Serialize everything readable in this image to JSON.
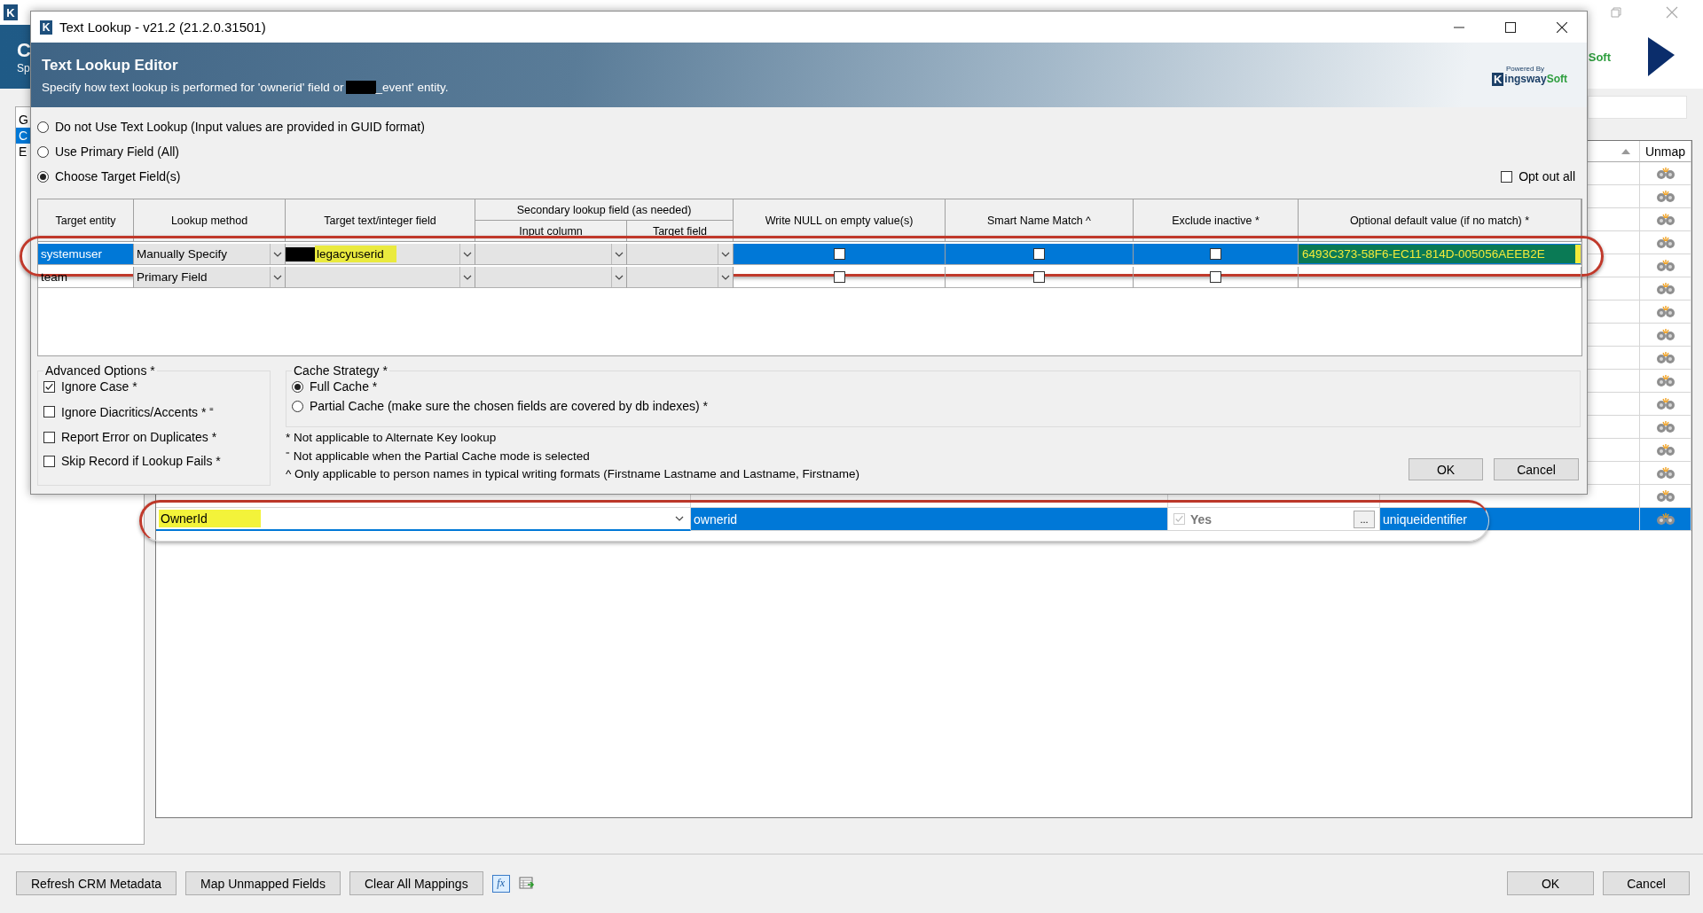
{
  "main_window": {
    "icon_letter": "K",
    "header": {
      "title_fragment": "C",
      "subtitle_fragment": "Sp",
      "logo_fragment": "Soft"
    },
    "list_items": [
      {
        "label": "G",
        "selected": false
      },
      {
        "label": "C",
        "selected": true
      },
      {
        "label": "E",
        "selected": false
      }
    ],
    "grid": {
      "unmap_header": "Unmap",
      "rows": [
        {
          "selected": false
        },
        {
          "selected": false
        },
        {
          "selected": false
        },
        {
          "selected": false
        },
        {
          "selected": false
        },
        {
          "selected": false
        },
        {
          "selected": false
        },
        {
          "selected": false
        },
        {
          "selected": false
        },
        {
          "selected": false
        },
        {
          "selected": false
        },
        {
          "selected": false
        },
        {
          "selected": false
        },
        {
          "selected": false
        },
        {
          "selected": false,
          "annotated": false
        },
        {
          "selected": true,
          "annotated": true,
          "source": "OwnerId",
          "source_highlighted": true,
          "destination": "ownerid",
          "key_checked": true,
          "key_label": "Yes",
          "key_button": "...",
          "type": "uniqueidentifier"
        }
      ]
    },
    "buttons": [
      "Refresh CRM Metadata",
      "Map Unmapped Fields",
      "Clear All Mappings"
    ],
    "formula_label": "fx",
    "dialog_buttons": [
      "OK",
      "Cancel"
    ]
  },
  "dialog": {
    "icon_letter": "K",
    "title": "Text Lookup - v21.2 (21.2.0.31501)",
    "banner": {
      "title": "Text Lookup Editor",
      "subtitle_before": "Specify how text lookup is performed for 'ownerid' field or",
      "subtitle_redacted": true,
      "subtitle_after": "_event' entity.",
      "logo_caption": "Powered By",
      "logo_letter": "K",
      "logo_name": "ingsway",
      "logo_suffix": "Soft"
    },
    "modes": [
      {
        "label": "Do not Use Text Lookup (Input values are provided in GUID format)",
        "selected": false
      },
      {
        "label": "Use Primary Field (All)",
        "selected": false
      },
      {
        "label": "Choose Target Field(s)",
        "selected": true
      }
    ],
    "opt_out": {
      "label": "Opt out all",
      "checked": false
    },
    "table": {
      "columns": [
        "Target entity",
        "Lookup method",
        "Target text/integer field",
        "Write NULL on empty value(s)",
        "Smart Name Match ^",
        "Exclude inactive *",
        "Optional default value (if no match) *"
      ],
      "secondary_group": "Secondary lookup field (as needed)",
      "secondary_columns": [
        "Input column",
        "Target field"
      ],
      "rows": [
        {
          "entity": "systemuser",
          "selected": true,
          "annotated": true,
          "method": "Manually Specify",
          "target_field": "legacyuserid",
          "target_field_redacted": true,
          "target_field_highlighted": true,
          "write_null": false,
          "smart_name": false,
          "exclude_inactive": false,
          "default_value": "6493C373-58F6-EC11-814D-005056AEEB2E",
          "default_highlighted": true
        },
        {
          "entity": "team",
          "selected": false,
          "annotated": false,
          "method": "Primary Field",
          "write_null": false,
          "smart_name": false,
          "exclude_inactive": false
        }
      ]
    },
    "advanced": {
      "title": "Advanced Options *",
      "options": [
        {
          "label": "Ignore Case *",
          "checked": true
        },
        {
          "label": "Ignore Diacritics/Accents * ⁼",
          "checked": false
        },
        {
          "label": "Report Error on Duplicates *",
          "checked": false
        },
        {
          "label": "Skip Record if Lookup Fails *",
          "checked": false
        }
      ]
    },
    "cache": {
      "title": "Cache Strategy *",
      "options": [
        {
          "label": "Full Cache *",
          "selected": true
        },
        {
          "label": "Partial Cache (make sure the chosen fields are covered by db indexes) *",
          "selected": false
        }
      ]
    },
    "notes": [
      "* Not applicable to Alternate Key lookup",
      "⁼ Not applicable when the Partial Cache mode is selected",
      "^ Only applicable to person names in typical writing formats (Firstname Lastname and Lastname, Firstname)"
    ],
    "buttons": [
      "OK",
      "Cancel"
    ]
  }
}
